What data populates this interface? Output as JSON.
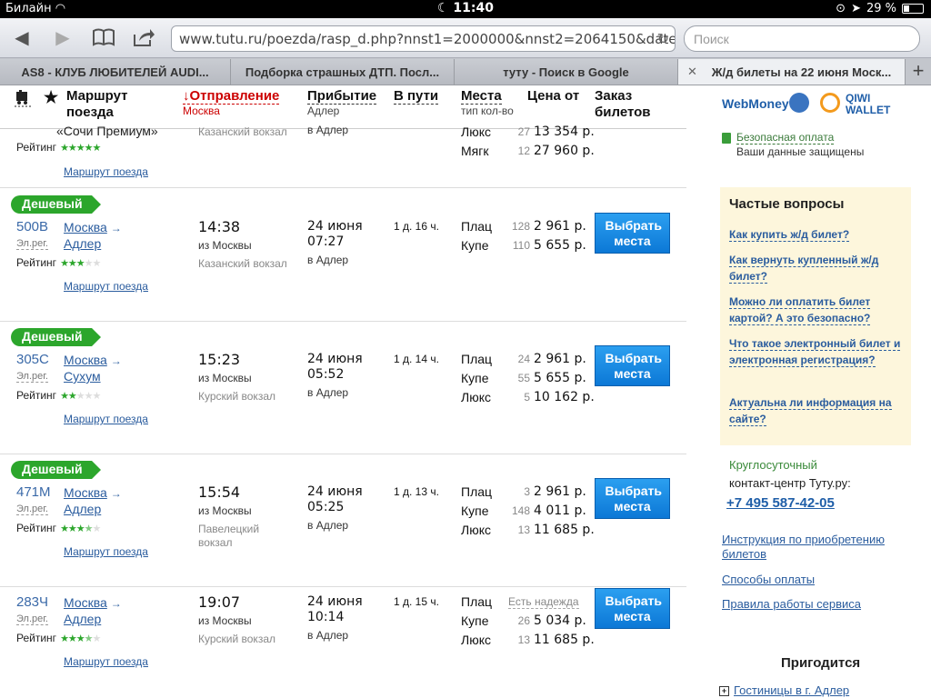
{
  "status": {
    "carrier": "Билайн",
    "time": "11:40",
    "battery": "29 %",
    "battery_level": 0.29
  },
  "browser": {
    "url": "www.tutu.ru/poezda/rasp_d.php?nnst1=2000000&nnst2=2064150&date=22.06",
    "search_placeholder": "Поиск",
    "tabs": [
      {
        "label": "AS8 - КЛУБ ЛЮБИТЕЛЕЙ AUDI..."
      },
      {
        "label": "Подборка страшных ДТП. Посл..."
      },
      {
        "label": "туту - Поиск в Google"
      },
      {
        "label": "Ж/д билеты на 22 июня Моск..."
      }
    ]
  },
  "table_header": {
    "route": "Маршрут поезда",
    "departure": "↓Отправление",
    "departure_sub": "Москва",
    "arrival": "Прибытие",
    "arrival_sub": "Адлер",
    "duration": "В пути",
    "seats": "Места",
    "seats_sub": "тип кол-во",
    "price": "Цена от",
    "order": "Заказ билетов"
  },
  "partial_row": {
    "route_name": "«Сочи Премиум»",
    "station": "Казанский вокзал",
    "arr_to": "в Адлер",
    "rating_label": "Рейтинг",
    "seats": [
      {
        "type": "Люкс",
        "count": "27",
        "price": "13 354 р."
      },
      {
        "type": "Мягк",
        "count": "12",
        "price": "27 960 р."
      }
    ],
    "route_link": "Маршрут поезда"
  },
  "trains": [
    {
      "badge": "Дешевый",
      "number": "500В",
      "elreg": "Эл.рег.",
      "from": "Москва",
      "to": "Адлер",
      "rating_label": "Рейтинг",
      "rating": 3,
      "dep_time": "14:38",
      "dep_from": "из Москвы",
      "station": "Казанский вокзал",
      "arr_date": "24 июня",
      "arr_time": "07:27",
      "arr_to": "в Адлер",
      "duration": "1 д. 16 ч.",
      "seats": [
        {
          "type": "Плац",
          "count": "128",
          "price": "2 961 р."
        },
        {
          "type": "Купе",
          "count": "110",
          "price": "5 655 р."
        }
      ],
      "button": "Выбрать места",
      "route_link": "Маршрут поезда"
    },
    {
      "badge": "Дешевый",
      "number": "305С",
      "elreg": "Эл.рег.",
      "from": "Москва",
      "to": "Сухум",
      "rating_label": "Рейтинг",
      "rating": 2,
      "dep_time": "15:23",
      "dep_from": "из Москвы",
      "station": "Курский вокзал",
      "arr_date": "24 июня",
      "arr_time": "05:52",
      "arr_to": "в Адлер",
      "duration": "1 д. 14 ч.",
      "seats": [
        {
          "type": "Плац",
          "count": "24",
          "price": "2 961 р."
        },
        {
          "type": "Купе",
          "count": "55",
          "price": "5 655 р."
        },
        {
          "type": "Люкс",
          "count": "5",
          "price": "10 162 р."
        }
      ],
      "button": "Выбрать места",
      "route_link": "Маршрут поезда"
    },
    {
      "badge": "Дешевый",
      "number": "471М",
      "elreg": "Эл.рег.",
      "from": "Москва",
      "to": "Адлер",
      "rating_label": "Рейтинг",
      "rating": 3.5,
      "dep_time": "15:54",
      "dep_from": "из Москвы",
      "station": "Павелецкий вокзал",
      "arr_date": "24 июня",
      "arr_time": "05:25",
      "arr_to": "в Адлер",
      "duration": "1 д. 13 ч.",
      "seats": [
        {
          "type": "Плац",
          "count": "3",
          "price": "2 961 р."
        },
        {
          "type": "Купе",
          "count": "148",
          "price": "4 011 р."
        },
        {
          "type": "Люкс",
          "count": "13",
          "price": "11 685 р."
        }
      ],
      "button": "Выбрать места",
      "route_link": "Маршрут поезда"
    },
    {
      "badge": "",
      "number": "283Ч",
      "elreg": "Эл.рег.",
      "from": "Москва",
      "to": "Адлер",
      "rating_label": "Рейтинг",
      "rating": 3.5,
      "dep_time": "19:07",
      "dep_from": "из Москвы",
      "station": "Курский вокзал",
      "arr_date": "24 июня",
      "arr_time": "10:14",
      "arr_to": "в Адлер",
      "duration": "1 д. 15 ч.",
      "seats": [
        {
          "type": "Плац",
          "count": "",
          "price": "",
          "note": "Есть надежда"
        },
        {
          "type": "Купе",
          "count": "26",
          "price": "5 034 р."
        },
        {
          "type": "Люкс",
          "count": "13",
          "price": "11 685 р."
        }
      ],
      "button": "Выбрать места",
      "route_link": "Маршрут поезда"
    }
  ],
  "sidebar": {
    "webmoney": "WebMoney",
    "qiwi": "QIWI WALLET",
    "secure_link": "Безопасная оплата",
    "secure_text": "Ваши данные защищены",
    "faq_title": "Частые вопросы",
    "faq": [
      "Как купить ж/д билет?",
      "Как вернуть купленный ж/д билет?",
      "Можно ли оплатить билет картой? А это безопасно?",
      "Что такое электронный билет и электронная регистрация?",
      "Актуальна ли информация на сайте?"
    ],
    "callcenter1": "Круглосуточный",
    "callcenter2": "контакт-центр Туту.ру:",
    "phone": "+7 495 587-42-05",
    "links": [
      "Инструкция по приобретению билетов",
      "Способы оплаты",
      "Правила работы сервиса"
    ],
    "useful": "Пригодится",
    "hotels": "Гостиницы в г. Адлер"
  }
}
